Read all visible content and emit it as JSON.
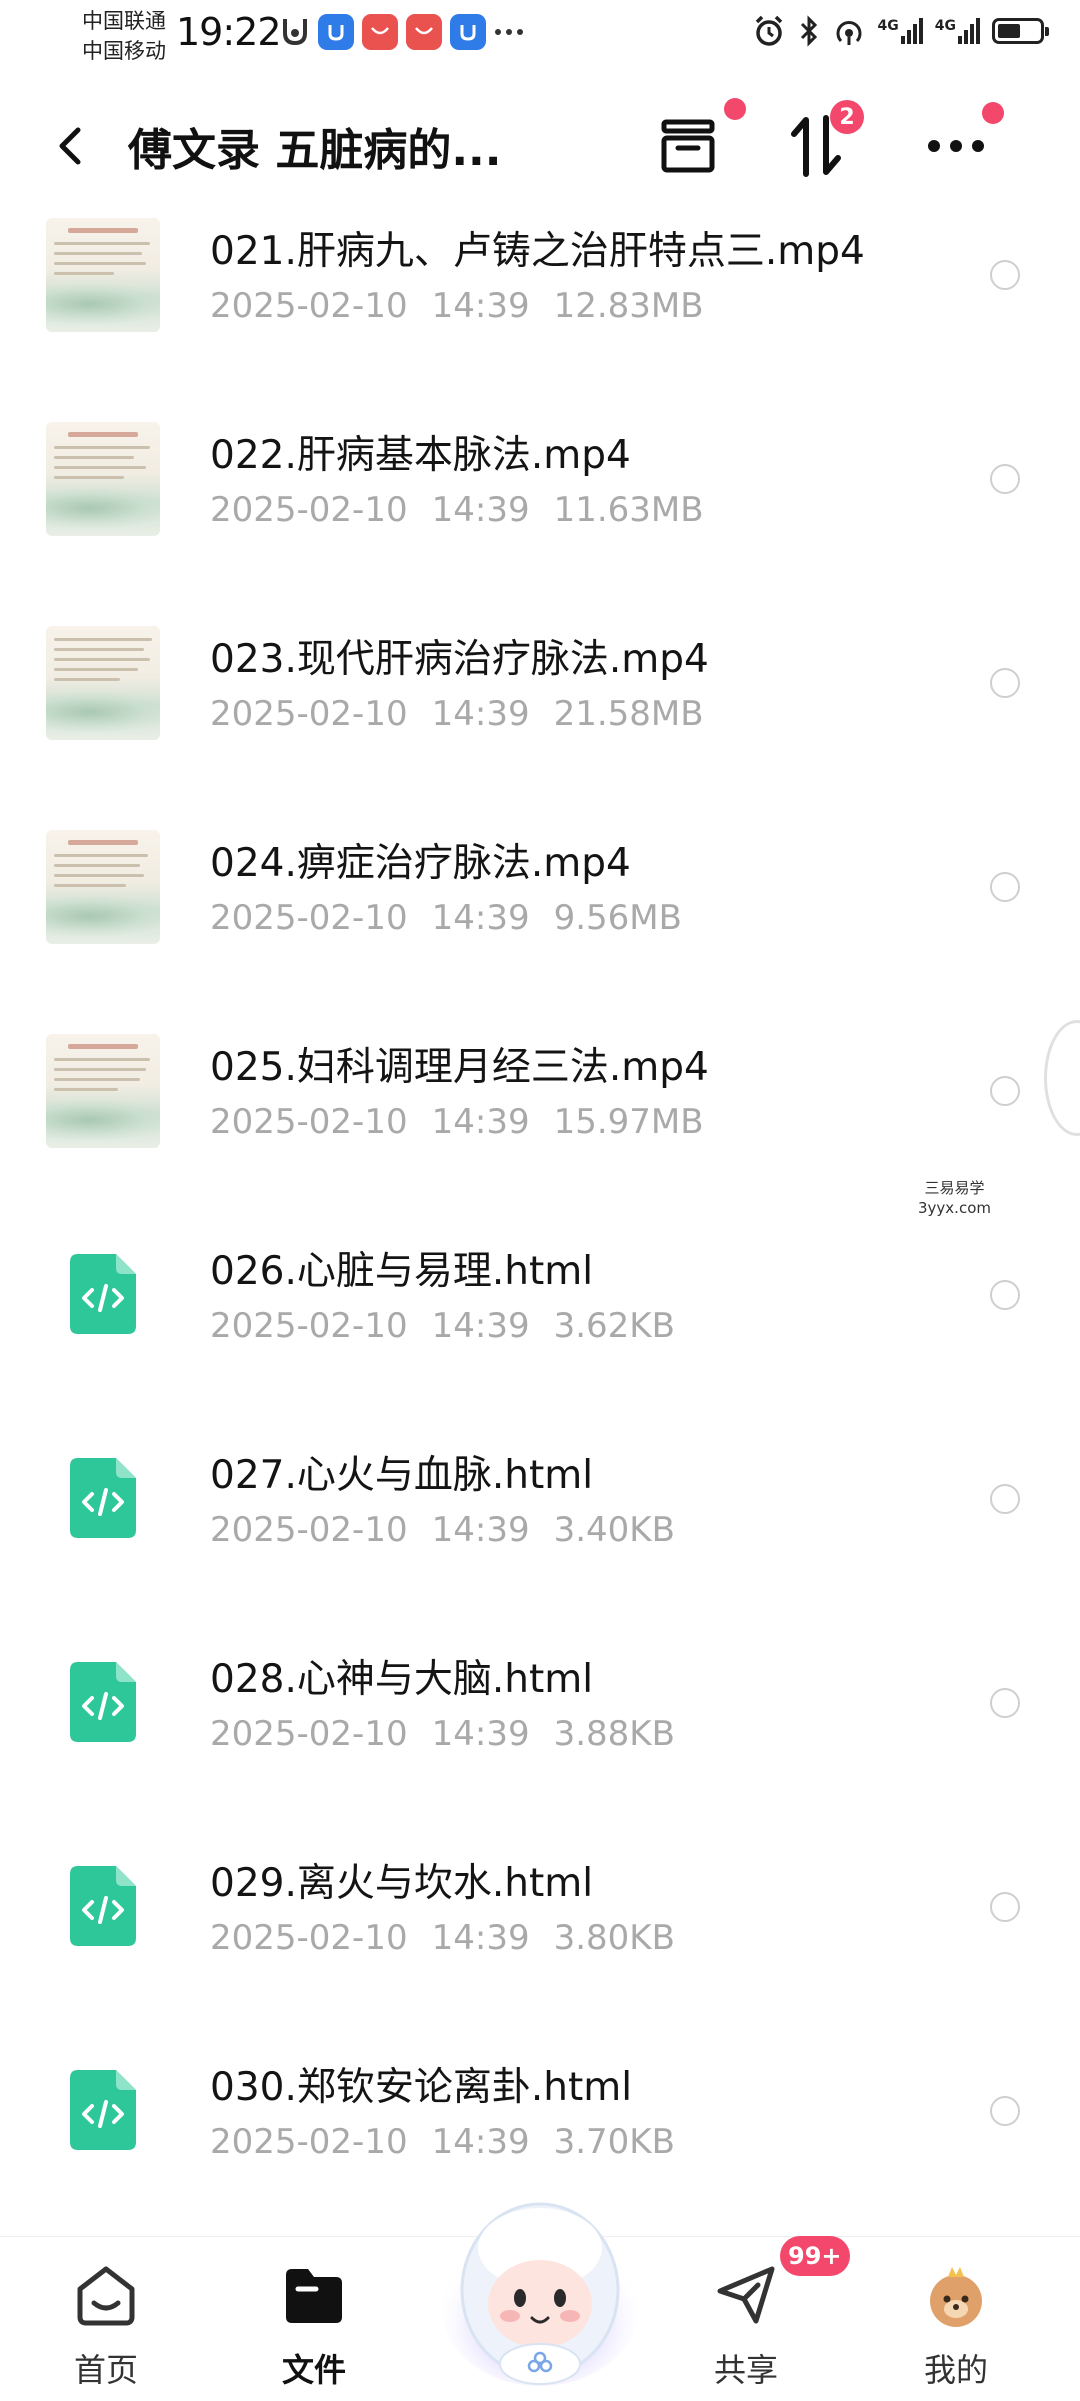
{
  "status_bar": {
    "carrier_1": "中国联通",
    "carrier_2": "中国移动",
    "time": "19:22",
    "network_1": "4G",
    "network_2": "4G",
    "battery_level": 0.55
  },
  "header": {
    "title": "傅文录 五脏病的...",
    "transfer_badge": "2"
  },
  "files": [
    {
      "name": "021.肝病九、卢铸之治肝特点三.mp4",
      "date": "2025-02-10",
      "time": "14:39",
      "size": "12.83MB",
      "type": "video"
    },
    {
      "name": "022.肝病基本脉法.mp4",
      "date": "2025-02-10",
      "time": "14:39",
      "size": "11.63MB",
      "type": "video"
    },
    {
      "name": "023.现代肝病治疗脉法.mp4",
      "date": "2025-02-10",
      "time": "14:39",
      "size": "21.58MB",
      "type": "video"
    },
    {
      "name": "024.痹症治疗脉法.mp4",
      "date": "2025-02-10",
      "time": "14:39",
      "size": "9.56MB",
      "type": "video"
    },
    {
      "name": "025.妇科调理月经三法.mp4",
      "date": "2025-02-10",
      "time": "14:39",
      "size": "15.97MB",
      "type": "video"
    },
    {
      "name": "026.心脏与易理.html",
      "date": "2025-02-10",
      "time": "14:39",
      "size": "3.62KB",
      "type": "html"
    },
    {
      "name": "027.心火与血脉.html",
      "date": "2025-02-10",
      "time": "14:39",
      "size": "3.40KB",
      "type": "html"
    },
    {
      "name": "028.心神与大脑.html",
      "date": "2025-02-10",
      "time": "14:39",
      "size": "3.88KB",
      "type": "html"
    },
    {
      "name": "029.离火与坎水.html",
      "date": "2025-02-10",
      "time": "14:39",
      "size": "3.80KB",
      "type": "html"
    },
    {
      "name": "030.郑钦安论离卦.html",
      "date": "2025-02-10",
      "time": "14:39",
      "size": "3.70KB",
      "type": "html"
    }
  ],
  "watermark": {
    "line_1": "三易易学",
    "line_2": "3yyx.com"
  },
  "bottom_nav": {
    "home": "首页",
    "files": "文件",
    "share": "共享",
    "share_badge": "99+",
    "mine": "我的",
    "active": "files"
  },
  "colors": {
    "accent_red": "#f3476b",
    "html_icon_green": "#2ec79a",
    "meta_gray": "#a9a9a9"
  }
}
